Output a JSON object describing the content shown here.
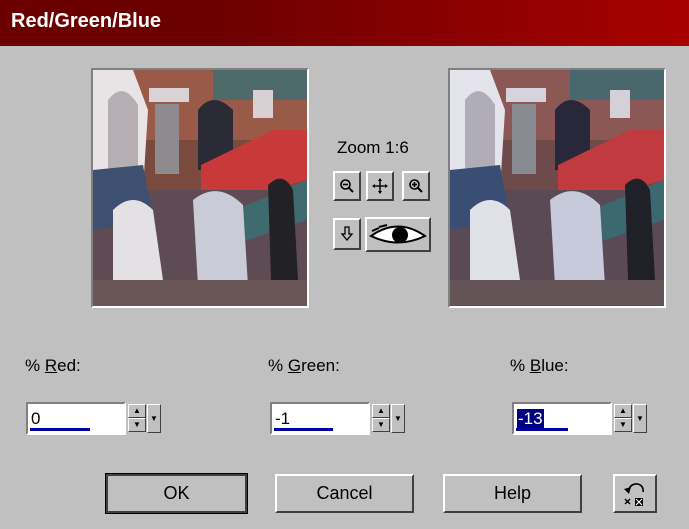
{
  "window": {
    "title": "Red/Green/Blue"
  },
  "preview": {
    "zoom_label": "Zoom 1:6"
  },
  "icons": {
    "zoom_out": "magnifier-minus-icon",
    "pan": "move-cross-icon",
    "zoom_in": "magnifier-plus-icon",
    "locate": "down-arrow-icon",
    "preview_toggle": "eye-icon",
    "reset": "undo-reset-icon"
  },
  "fields": {
    "red": {
      "label_prefix": "% ",
      "label_key": "R",
      "label_rest": "ed:",
      "value": "0",
      "level": 0.62
    },
    "green": {
      "label_prefix": "% ",
      "label_key": "G",
      "label_rest": "reen:",
      "value": "-1",
      "level": 0.61
    },
    "blue": {
      "label_prefix": "% ",
      "label_key": "B",
      "label_rest": "lue:",
      "value": "-13",
      "level": 0.54
    }
  },
  "buttons": {
    "ok": "OK",
    "cancel": "Cancel",
    "help": "Help"
  },
  "colors": {
    "titlebar_start": "#6b0000",
    "titlebar_end": "#a80000",
    "dialog_bg": "#c0c0c0",
    "selection": "#000080"
  }
}
